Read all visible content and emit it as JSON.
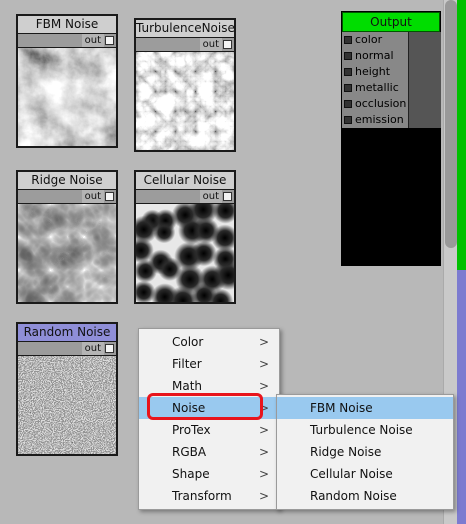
{
  "nodes": [
    {
      "title": "FBM Noise",
      "port": "out"
    },
    {
      "title": "TurbulenceNoise",
      "port": "out"
    },
    {
      "title": "Ridge Noise",
      "port": "out"
    },
    {
      "title": "Cellular Noise",
      "port": "out"
    },
    {
      "title": "Random Noise",
      "port": "out"
    }
  ],
  "output": {
    "title": "Output",
    "inputs": [
      "color",
      "normal",
      "height",
      "metallic",
      "occlusion",
      "emission"
    ]
  },
  "context_menu": {
    "items": [
      "Color",
      "Filter",
      "Math",
      "Noise",
      "ProTex",
      "RGBA",
      "Shape",
      "Transform"
    ],
    "arrow": ">",
    "highlighted": "Noise"
  },
  "submenu": {
    "items": [
      "FBM Noise",
      "Turbulence Noise",
      "Ridge Noise",
      "Cellular Noise",
      "Random Noise"
    ],
    "highlighted": "FBM Noise"
  },
  "colors": {
    "output_header": "#00dd00",
    "selected_node_header": "#8f8ed8",
    "menu_highlight": "#99c9ef",
    "callout": "#e8141c"
  }
}
